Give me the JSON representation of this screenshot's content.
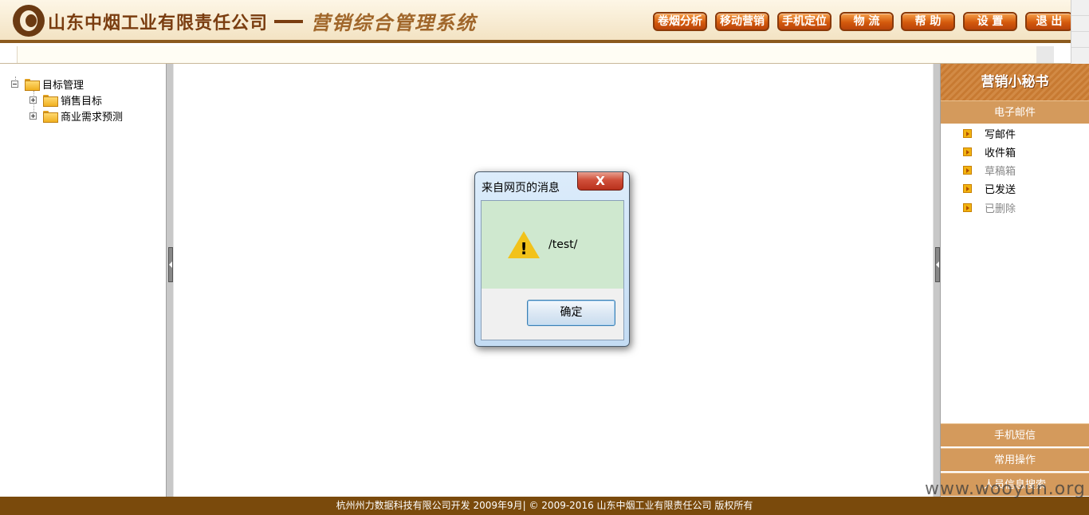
{
  "header": {
    "company": "山东中烟工业有限责任公司",
    "system": "营销综合管理系统",
    "nav": [
      "卷烟分析",
      "移动营销",
      "手机定位",
      "物 流",
      "帮 助",
      "设 置",
      "退 出"
    ]
  },
  "tree": {
    "root": "目标管理",
    "children": [
      "销售目标",
      "商业需求预测"
    ]
  },
  "secretary": {
    "title": "营销小秘书",
    "email_header": "电子邮件",
    "mail_items": [
      "写邮件",
      "收件箱",
      "草稿箱",
      "已发送",
      "已删除"
    ],
    "bottom_bars": [
      "手机短信",
      "常用操作",
      "人员信息搜索"
    ]
  },
  "dialog": {
    "title": "来自网页的消息",
    "close": "X",
    "message": "/test/",
    "ok": "确定"
  },
  "footer": "杭州州力数据科技有限公司开发 2009年9月| © 2009-2016 山东中烟工业有限责任公司 版权所有",
  "watermark": "www.wooyun.org",
  "colors": {
    "brand_brown": "#7a3d10",
    "panel_orange": "#d49a5c",
    "footer": "#7a4a0c"
  }
}
